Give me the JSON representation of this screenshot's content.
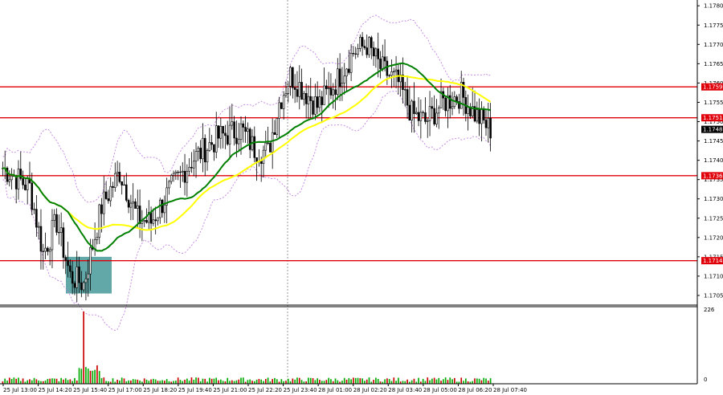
{
  "chart_data": {
    "type": "candlestick",
    "symbol_context": "EURUSD M5",
    "price_axis": {
      "ticks": [
        "1.1780",
        "1.1775",
        "1.1770",
        "1.1765",
        "1.1760",
        "1.1755",
        "1.1750",
        "1.1745",
        "1.1740",
        "1.1735",
        "1.1730",
        "1.1725",
        "1.1720",
        "1.1715",
        "1.1710",
        "1.1705"
      ],
      "ylim": [
        1.17025,
        1.17815
      ]
    },
    "volume_axis": {
      "ticks": [
        "226",
        "0"
      ],
      "max": 226
    },
    "time_axis": {
      "ticks": [
        "25 Jul 13:00",
        "25 Jul 14:20",
        "25 Jul 15:40",
        "25 Jul 17:00",
        "25 Jul 18:20",
        "25 Jul 19:40",
        "25 Jul 21:00",
        "25 Jul 22:20",
        "25 Jul 23:40",
        "28 Jul 01:00",
        "28 Jul 02:20",
        "28 Jul 03:40",
        "28 Jul 05:00",
        "28 Jul 06:20",
        "28 Jul 07:40"
      ]
    },
    "levels": [
      {
        "label": "1.1759",
        "value": 1.1759,
        "color": "#e0000a"
      },
      {
        "label": "1.1751",
        "value": 1.1751,
        "color": "#e0000a"
      },
      {
        "label": "1.1736",
        "value": 1.1736,
        "color": "#e0000a"
      },
      {
        "label": "1.1714",
        "value": 1.1714,
        "color": "#e0000a"
      }
    ],
    "last_price": {
      "label": "1.1748",
      "value": 1.1748,
      "color": "#000000"
    },
    "session_separator_label": "25 Jul 23:40",
    "highlight_zone": {
      "from_label": "25 Jul 15:00",
      "to_label": "25 Jul 16:05",
      "price_low": 1.17055,
      "price_high": 1.1715,
      "color": "#2e8b8b"
    },
    "candle_count": 218,
    "price_path": [
      {
        "t": 0,
        "p": 1.1738
      },
      {
        "t": 12,
        "p": 1.1733
      },
      {
        "t": 18,
        "p": 1.1716
      },
      {
        "t": 24,
        "p": 1.1724
      },
      {
        "t": 30,
        "p": 1.171
      },
      {
        "t": 36,
        "p": 1.1708
      },
      {
        "t": 44,
        "p": 1.1728
      },
      {
        "t": 52,
        "p": 1.1737
      },
      {
        "t": 60,
        "p": 1.1725
      },
      {
        "t": 66,
        "p": 1.1724
      },
      {
        "t": 74,
        "p": 1.1732
      },
      {
        "t": 84,
        "p": 1.174
      },
      {
        "t": 96,
        "p": 1.1746
      },
      {
        "t": 106,
        "p": 1.1748
      },
      {
        "t": 112,
        "p": 1.1743
      },
      {
        "t": 118,
        "p": 1.1742
      },
      {
        "t": 123,
        "p": 1.1755
      },
      {
        "t": 128,
        "p": 1.1762
      },
      {
        "t": 134,
        "p": 1.1758
      },
      {
        "t": 140,
        "p": 1.1754
      },
      {
        "t": 148,
        "p": 1.176
      },
      {
        "t": 156,
        "p": 1.1768
      },
      {
        "t": 162,
        "p": 1.177
      },
      {
        "t": 168,
        "p": 1.1764
      },
      {
        "t": 176,
        "p": 1.176
      },
      {
        "t": 182,
        "p": 1.1752
      },
      {
        "t": 188,
        "p": 1.175
      },
      {
        "t": 196,
        "p": 1.1755
      },
      {
        "t": 204,
        "p": 1.1757
      },
      {
        "t": 210,
        "p": 1.1752
      },
      {
        "t": 217,
        "p": 1.1748
      }
    ],
    "indicators": [
      {
        "color": "#ffff00",
        "period": 50
      },
      {
        "color": "#008000",
        "period": 30
      },
      {
        "color": "#c080e0",
        "style": "dashed envelope"
      }
    ],
    "grid": false
  }
}
